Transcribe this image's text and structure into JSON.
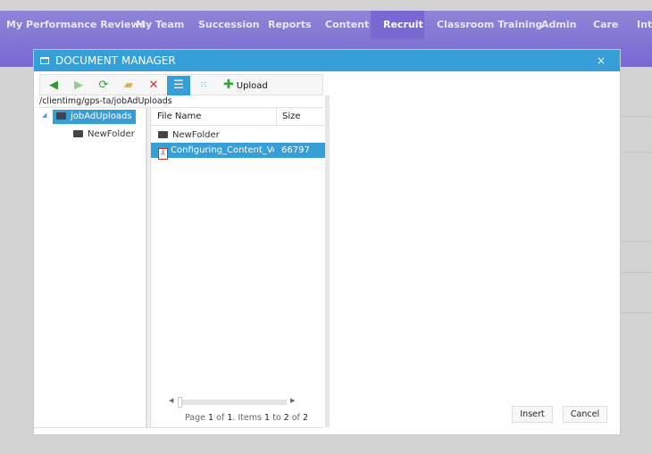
{
  "nav": {
    "items": [
      "My Performance Reviews",
      "My Team",
      "Succession",
      "Reports",
      "Content",
      "Recruit",
      "Classroom Training",
      "Admin",
      "Care",
      "Inte"
    ],
    "active": "Recruit"
  },
  "dialog": {
    "title": "DOCUMENT MANAGER",
    "close_label": "×",
    "toolbar": {
      "icons": [
        "back-arrow",
        "forward-arrow",
        "refresh",
        "new-folder",
        "delete",
        "list-view",
        "thumbnail-view"
      ],
      "upload_label": "Upload"
    },
    "path": "/clientimg/gps-ta/jobAdUploads",
    "tree": {
      "root": "jobAdUploads",
      "children": [
        "NewFolder"
      ]
    },
    "grid": {
      "columns": [
        "File Name",
        "Size"
      ],
      "rows": [
        {
          "name": "NewFolder",
          "size": "",
          "type": "folder"
        },
        {
          "name": "Configuring_Content_Vendors.pdf",
          "size": "66797",
          "type": "pdf",
          "selected": true
        }
      ]
    },
    "pager": {
      "prefix": "Page",
      "page": "1",
      "of1": "of",
      "total_pages": "1",
      "items": ". Items",
      "from": "1",
      "to_word": "to",
      "to": "2",
      "of2": "of",
      "total": "2"
    },
    "insert_label": "Insert",
    "cancel_label": "Cancel"
  },
  "colors": {
    "accent": "#379fd8",
    "nav": "#7868d4"
  }
}
